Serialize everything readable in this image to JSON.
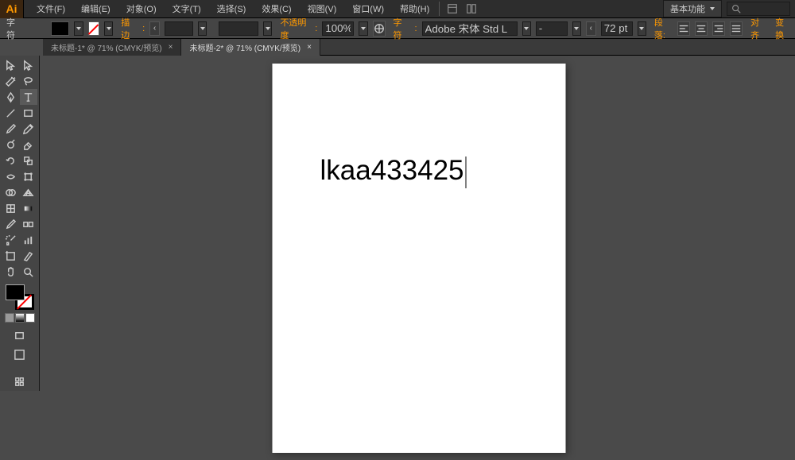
{
  "app": {
    "logo": "Ai"
  },
  "menubar": {
    "items": [
      "文件(F)",
      "编辑(E)",
      "对象(O)",
      "文字(T)",
      "选择(S)",
      "效果(C)",
      "视图(V)",
      "窗口(W)",
      "帮助(H)"
    ],
    "workspace": "基本功能"
  },
  "controlbar": {
    "panel_label": "字符",
    "stroke_label": "描边",
    "stroke_weight": "",
    "dash_value": "",
    "opacity_label": "不透明度",
    "opacity_value": "100%",
    "character_label": "字符",
    "font_family": "Adobe 宋体 Std L",
    "font_style": "-",
    "font_size": "72 pt",
    "paragraph_label": "段落:",
    "align_label": "对齐",
    "transform_label": "变换"
  },
  "tabs": [
    {
      "label": "未标题-1* @ 71% (CMYK/预览)",
      "active": false
    },
    {
      "label": "未标题-2* @ 71% (CMYK/预览)",
      "active": true
    }
  ],
  "canvas": {
    "text": "lkaa433425"
  },
  "tools": [
    "selection",
    "direct-selection",
    "magic-wand",
    "lasso",
    "pen",
    "type",
    "line",
    "rectangle",
    "paintbrush",
    "pencil",
    "blob-brush",
    "eraser",
    "rotate",
    "scale",
    "width",
    "warp",
    "shape-builder",
    "live-paint",
    "perspective",
    "mesh",
    "gradient",
    "eyedropper",
    "blend",
    "symbol-spray",
    "column-graph",
    "artboard",
    "slice",
    "hand",
    "zoom",
    ""
  ],
  "colors": {
    "fill": "#000000",
    "stroke": "none"
  }
}
